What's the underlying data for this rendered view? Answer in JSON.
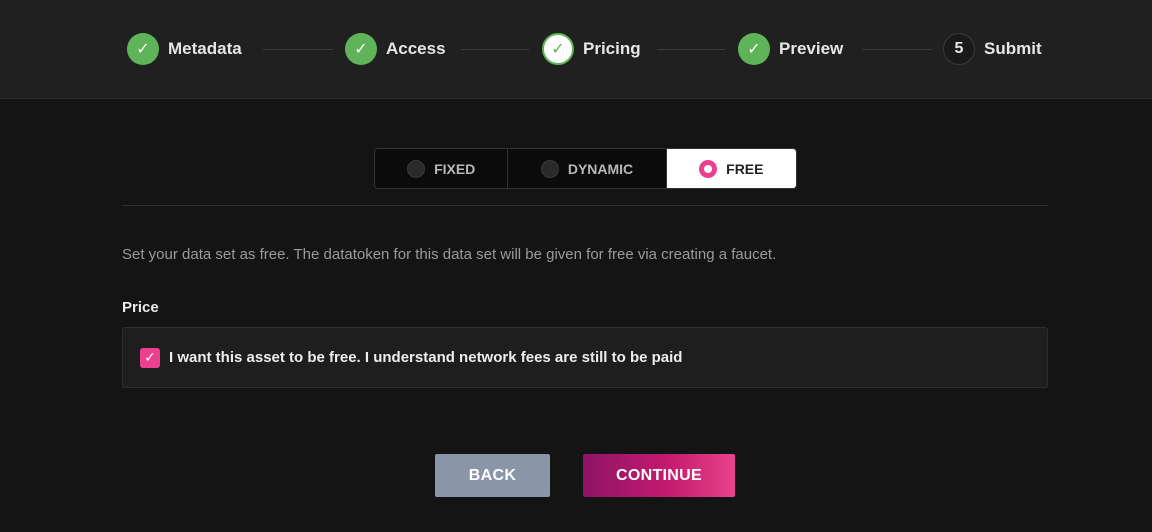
{
  "stepper": {
    "steps": [
      {
        "label": "Metadata",
        "mark": "✓",
        "state": "done"
      },
      {
        "label": "Access",
        "mark": "✓",
        "state": "done"
      },
      {
        "label": "Pricing",
        "mark": "✓",
        "state": "active"
      },
      {
        "label": "Preview",
        "mark": "✓",
        "state": "done"
      },
      {
        "label": "Submit",
        "mark": "5",
        "state": "todo"
      }
    ]
  },
  "pricing_tabs": {
    "options": [
      "FIXED",
      "DYNAMIC",
      "FREE"
    ],
    "selected": "FREE"
  },
  "description": "Set your data set as free. The datatoken for this data set will be given for free via creating a faucet.",
  "price": {
    "label": "Price",
    "checkbox_label": "I want this asset to be free. I understand network fees are still to be paid",
    "checked": true,
    "check_mark": "✓"
  },
  "actions": {
    "back_label": "BACK",
    "continue_label": "CONTINUE"
  },
  "colors": {
    "accent_pink": "#ec3f8e",
    "step_green": "#5fb358",
    "back_button": "#8a96a8"
  },
  "icons": {
    "step_done": "check-icon",
    "radio": "radio-icon",
    "checkbox": "checkbox-checked-icon"
  }
}
